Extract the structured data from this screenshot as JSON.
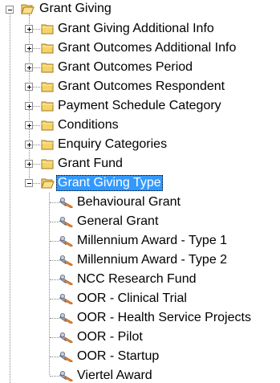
{
  "tree": {
    "root": {
      "label": "Grant Giving",
      "icon": "folder-open-icon",
      "state": "expanded"
    },
    "children": [
      {
        "label": "Grant Giving Additional Info",
        "icon": "folder-icon",
        "state": "collapsed"
      },
      {
        "label": "Grant Outcomes Additional Info",
        "icon": "folder-icon",
        "state": "collapsed"
      },
      {
        "label": "Grant Outcomes Period",
        "icon": "folder-icon",
        "state": "collapsed"
      },
      {
        "label": "Grant Outcomes Respondent",
        "icon": "folder-icon",
        "state": "collapsed"
      },
      {
        "label": "Payment Schedule Category",
        "icon": "folder-icon",
        "state": "collapsed"
      },
      {
        "label": "Conditions",
        "icon": "folder-icon",
        "state": "collapsed"
      },
      {
        "label": "Enquiry Categories",
        "icon": "folder-icon",
        "state": "collapsed"
      },
      {
        "label": "Grant Fund",
        "icon": "folder-icon",
        "state": "collapsed"
      },
      {
        "label": "Grant Giving Type",
        "icon": "folder-open-icon",
        "state": "expanded",
        "selected": true
      }
    ],
    "grant_giving_type_items": [
      "Behavioural Grant",
      "General Grant",
      "Millennium Award - Type 1",
      "Millennium Award - Type 2",
      "NCC Research Fund",
      "OOR - Clinical Trial",
      "OOR - Health Service Projects",
      "OOR - Pilot",
      "OOR - Startup",
      "Viertel Award"
    ]
  },
  "colors": {
    "selection_bg": "#3399ff",
    "selection_text": "#ffffff",
    "folder_fill": "#f5d36b",
    "folder_stroke": "#b8860b",
    "connector": "#8a8a8a"
  }
}
